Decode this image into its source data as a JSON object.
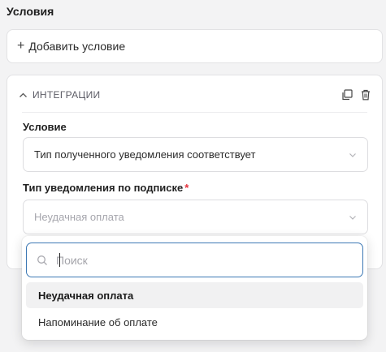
{
  "conditions": {
    "title": "Условия",
    "add_label": "Добавить условие"
  },
  "integration": {
    "title": "ИНТЕГРАЦИИ",
    "icons": {
      "toggle": "chevron-up-icon",
      "copy": "copy-icon",
      "delete": "trash-icon"
    },
    "condition_field": {
      "label": "Условие",
      "value": "Тип полученного уведомления соответствует"
    },
    "type_field": {
      "label": "Тип уведомления по подписке",
      "required_mark": "*",
      "placeholder": "Неудачная оплата"
    }
  },
  "dropdown": {
    "search_placeholder": "Поиск",
    "options": [
      {
        "label": "Неудачная оплата",
        "highlighted": true
      },
      {
        "label": "Напоминание об оплате",
        "highlighted": false
      }
    ]
  },
  "colors": {
    "accent_border": "#3c78b4",
    "required": "#e5303b",
    "background": "#f3f3f4"
  }
}
